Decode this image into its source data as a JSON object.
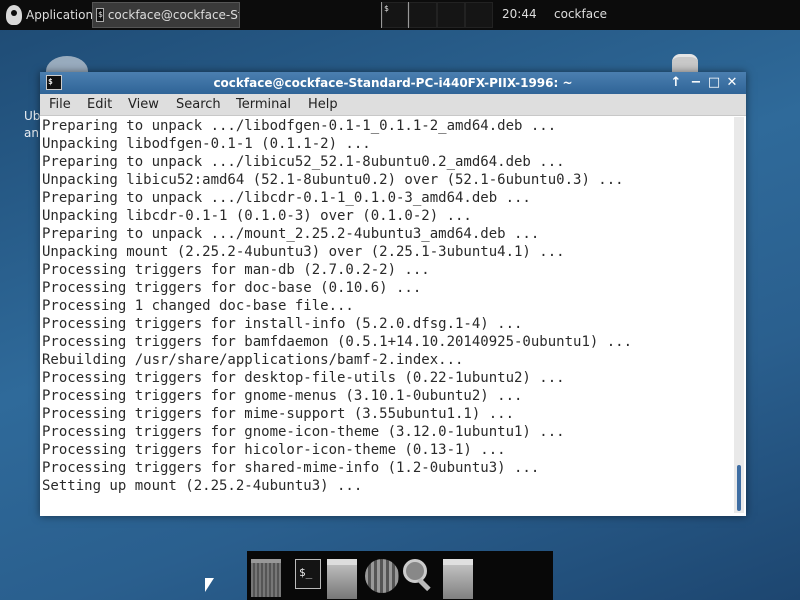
{
  "panel": {
    "applications_label": "Applications",
    "task_label": "cockface@cockface-Sta...",
    "clock": "20:44",
    "user": "cockface"
  },
  "desktop": {
    "left_text_line1": "Ub",
    "left_text_line2": "an"
  },
  "window": {
    "title": "cockface@cockface-Standard-PC-i440FX-PIIX-1996: ~",
    "controls": {
      "up": "↑",
      "minimize": "−",
      "maximize": "□",
      "close": "✕"
    },
    "menu": [
      "File",
      "Edit",
      "View",
      "Search",
      "Terminal",
      "Help"
    ]
  },
  "terminal": {
    "lines": [
      "Preparing to unpack .../libodfgen-0.1-1_0.1.1-2_amd64.deb ...",
      "Unpacking libodfgen-0.1-1 (0.1.1-2) ...",
      "Preparing to unpack .../libicu52_52.1-8ubuntu0.2_amd64.deb ...",
      "Unpacking libicu52:amd64 (52.1-8ubuntu0.2) over (52.1-6ubuntu0.3) ...",
      "Preparing to unpack .../libcdr-0.1-1_0.1.0-3_amd64.deb ...",
      "Unpacking libcdr-0.1-1 (0.1.0-3) over (0.1.0-2) ...",
      "Preparing to unpack .../mount_2.25.2-4ubuntu3_amd64.deb ...",
      "Unpacking mount (2.25.2-4ubuntu3) over (2.25.1-3ubuntu4.1) ...",
      "Processing triggers for man-db (2.7.0.2-2) ...",
      "Processing triggers for doc-base (0.10.6) ...",
      "Processing 1 changed doc-base file...",
      "Processing triggers for install-info (5.2.0.dfsg.1-4) ...",
      "Processing triggers for bamfdaemon (0.5.1+14.10.20140925-0ubuntu1) ...",
      "Rebuilding /usr/share/applications/bamf-2.index...",
      "Processing triggers for desktop-file-utils (0.22-1ubuntu2) ...",
      "Processing triggers for gnome-menus (3.10.1-0ubuntu2) ...",
      "Processing triggers for mime-support (3.55ubuntu1.1) ...",
      "Processing triggers for gnome-icon-theme (3.12.0-1ubuntu1) ...",
      "Processing triggers for hicolor-icon-theme (0.13-1) ...",
      "Processing triggers for shared-mime-info (1.2-0ubuntu3) ...",
      "Setting up mount (2.25.2-4ubuntu3) ..."
    ]
  },
  "dock": {
    "terminal_glyph": "$_"
  },
  "colors": {
    "titlebar": "#3a6ea0",
    "accent": "#3f6ea3",
    "panel": "#0c0c0c",
    "terminal_text": "#2a2a2a"
  }
}
